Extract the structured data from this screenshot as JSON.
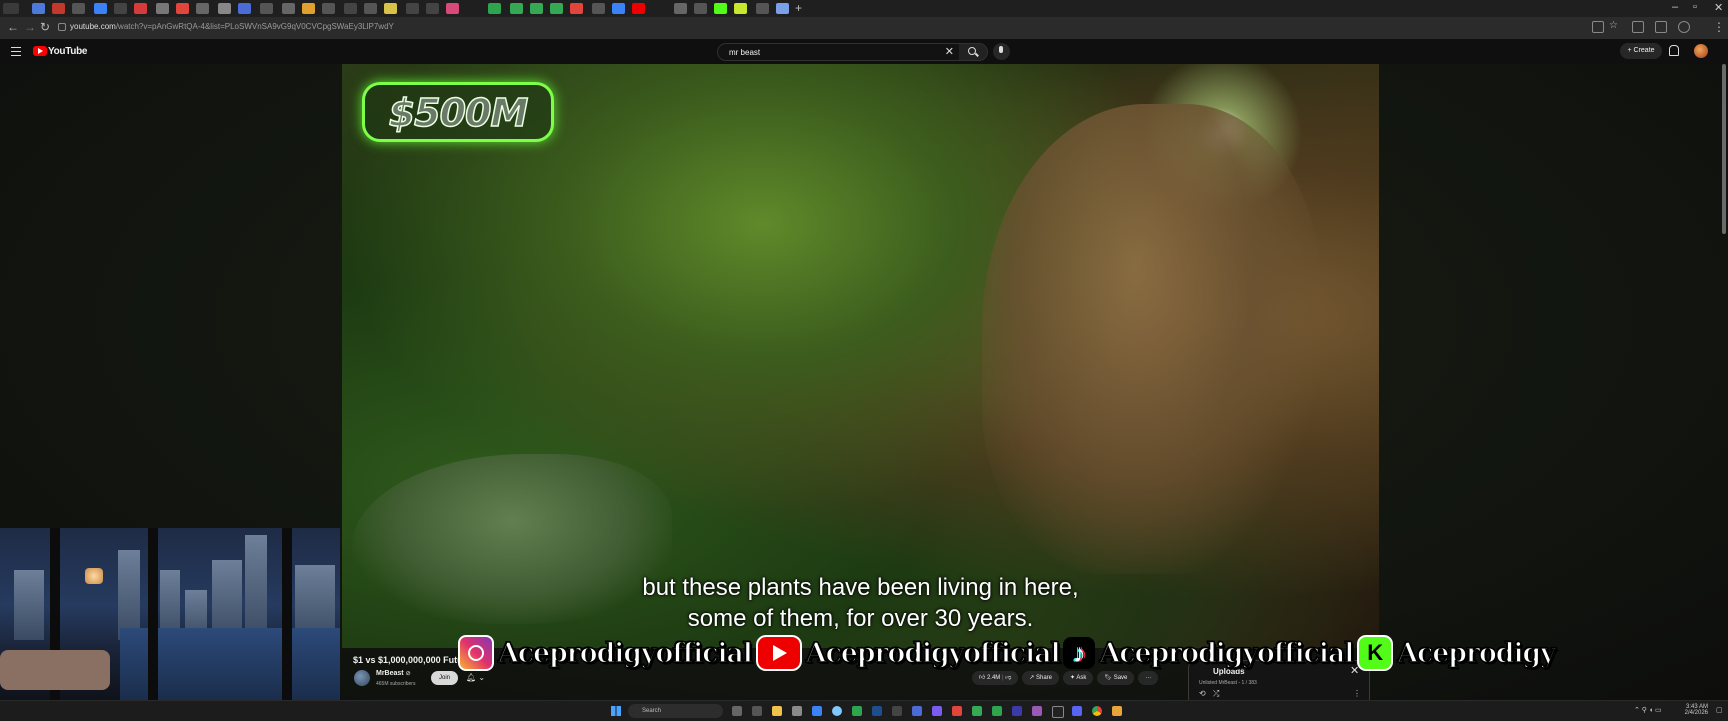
{
  "browser": {
    "url_host": "youtube.com",
    "url_path": "/watch?v=pAnGwRtQA-4&list=PLoSWVnSA9vG9qV0CVCpgSWaEy3LlP7wdY"
  },
  "youtube_header": {
    "logo_text": "YouTube",
    "search_value": "mr beast",
    "create_label": "Create"
  },
  "video": {
    "overlay_badge": "$500M",
    "subtitle_line1": "but these plants have been living in here,",
    "subtitle_line2": "some of them, for over 30 years.",
    "watermark": [
      "Aceprodigyofficial",
      "Aceprodigyofficial",
      "Aceprodigyofficial",
      "Aceprodigy"
    ]
  },
  "video_info": {
    "title": "$1 vs $1,000,000,000 Futu",
    "channel_name": "MrBeast",
    "verified_mark": "⊘",
    "subscribers": "465M subscribers",
    "join_label": "Join",
    "like_count": "2.4M",
    "share_label": "Share",
    "ask_label": "Ask",
    "save_label": "Save"
  },
  "playlist": {
    "title": "Uploads",
    "meta": "Unlisted  MrBeast - 1 / 383"
  },
  "taskbar": {
    "search_placeholder": "Search",
    "time": "3:43 AM",
    "date": "2/4/2026"
  },
  "icons": [
    "back-icon",
    "forward-icon",
    "reload-icon",
    "menu-icon",
    "youtube-logo-icon",
    "search-icon",
    "mic-icon",
    "bell-icon",
    "like-icon",
    "dislike-icon",
    "share-icon",
    "bookmark-icon",
    "windows-start-icon"
  ],
  "colors": {
    "youtube_red": "#ff0000",
    "badge_glow": "#7dff4a",
    "kick_green": "#53fc18",
    "page_bg": "#0f0f0f"
  }
}
